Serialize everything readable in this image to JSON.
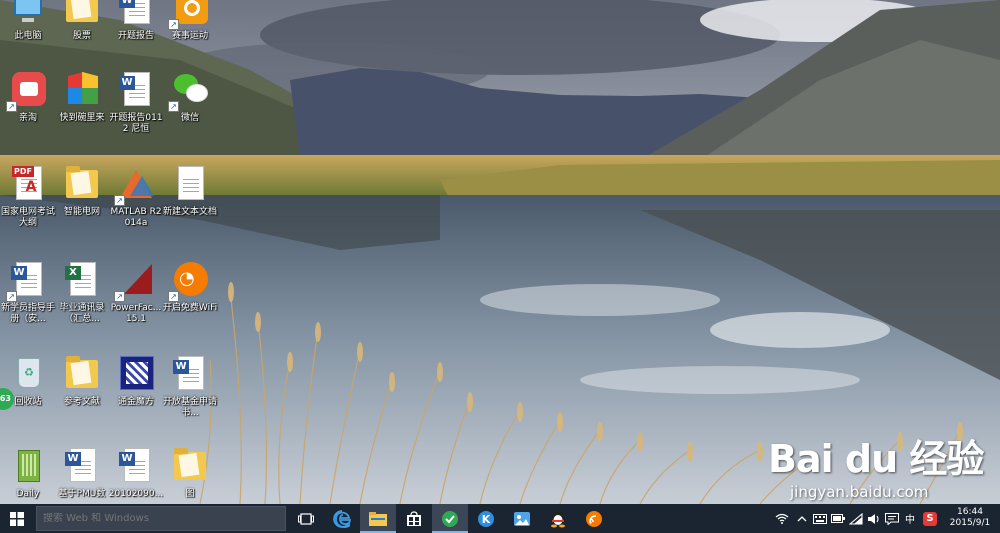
{
  "desktop": {
    "icons": [
      {
        "label": "此电脑"
      },
      {
        "label": "股票"
      },
      {
        "label": "开题报告"
      },
      {
        "label": "赛事运动"
      },
      {
        "label": "亲淘"
      },
      {
        "label": "快到碗里来"
      },
      {
        "label": "开题报告0112 尼恒"
      },
      {
        "label": "微信"
      },
      {
        "label": "国家电网考试大纲"
      },
      {
        "label": "智能电网"
      },
      {
        "label": "MATLAB R2014a"
      },
      {
        "label": "新建文本文档"
      },
      {
        "label": "新学员指导手册（安..."
      },
      {
        "label": "毕业通讯录（汇总..."
      },
      {
        "label": "PowerFac... 15.1"
      },
      {
        "label": "开启免费WiFi"
      },
      {
        "label": "回收站"
      },
      {
        "label": "参考文献"
      },
      {
        "label": "通金魔方"
      },
      {
        "label": "开放基金申请书..."
      },
      {
        "label": "Daily"
      },
      {
        "label": "基于PMU数"
      },
      {
        "label": "20102090..."
      },
      {
        "label": "图"
      }
    ],
    "side_badge": "63"
  },
  "watermark": {
    "brand": "Bai du 经验",
    "url": "jingyan.baidu.com"
  },
  "taskbar": {
    "search_placeholder": "搜索 Web 和 Windows",
    "tray": {
      "ime": "中",
      "antivirus": "S"
    },
    "clock": {
      "time": "16:44",
      "date": "2015/9/1"
    }
  },
  "colors": {
    "taskbar_bg": "#1b2431",
    "search_bg": "#3a4250",
    "active_indicator": "#7fb6e6"
  }
}
